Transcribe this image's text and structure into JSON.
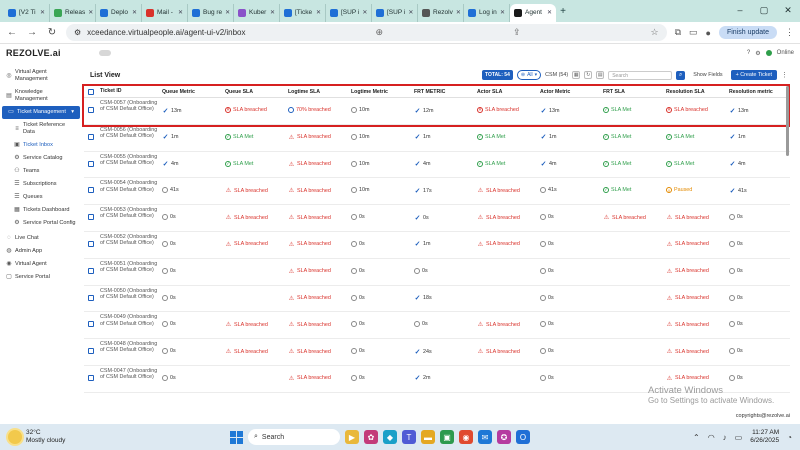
{
  "browser": {
    "tabs": [
      {
        "label": "[V2 Ti",
        "color": "#1f6fd6"
      },
      {
        "label": "Releas",
        "color": "#3aa655"
      },
      {
        "label": "Deplo",
        "color": "#1f6fd6"
      },
      {
        "label": "Mail -",
        "color": "#d9322b"
      },
      {
        "label": "Bug re",
        "color": "#1f6fd6"
      },
      {
        "label": "Kuber",
        "color": "#8a52c9"
      },
      {
        "label": "[Ticke",
        "color": "#1f6fd6"
      },
      {
        "label": "[SUP i",
        "color": "#1f6fd6"
      },
      {
        "label": "[SUP i",
        "color": "#1f6fd6"
      },
      {
        "label": "Rezolv",
        "color": "#555555"
      },
      {
        "label": "Log in",
        "color": "#1f6fd6"
      },
      {
        "label": "Agent",
        "color": "#1a1a1a",
        "active": true
      }
    ],
    "url": "xceedance.virtualpeople.ai/agent-ui-v2/inbox",
    "finish_update": "Finish update"
  },
  "app": {
    "logo": "REZOLVE.ai",
    "user_status": "Online"
  },
  "sidebar": {
    "items": [
      {
        "label": "Virtual Agent Management",
        "icon": "bot-icon"
      },
      {
        "label": "Knowledge Management",
        "icon": "book-icon"
      },
      {
        "label": "Ticket Management",
        "icon": "ticket-icon",
        "active": true
      },
      {
        "label": "Ticket Reference Data",
        "icon": "list-icon",
        "sub": true
      },
      {
        "label": "Ticket Inbox",
        "icon": "inbox-icon",
        "sub": true,
        "current": true
      },
      {
        "label": "Service Catalog",
        "icon": "catalog-icon",
        "sub": true
      },
      {
        "label": "Teams",
        "icon": "team-icon",
        "sub": true
      },
      {
        "label": "Subscriptions",
        "icon": "subscription-icon",
        "sub": true
      },
      {
        "label": "Queues",
        "icon": "queue-icon",
        "sub": true
      },
      {
        "label": "Tickets Dashboard",
        "icon": "dashboard-icon",
        "sub": true
      },
      {
        "label": "Service Portal Config",
        "icon": "config-icon",
        "sub": true
      },
      {
        "label": "Live Chat",
        "icon": "chat-icon"
      },
      {
        "label": "Admin App",
        "icon": "admin-icon"
      },
      {
        "label": "Virtual Agent",
        "icon": "agent-icon"
      },
      {
        "label": "Service Portal",
        "icon": "portal-icon"
      }
    ]
  },
  "list": {
    "title": "List View",
    "total": "TOTAL: 54",
    "filter_label": "All",
    "csm_select": "CSM (54)",
    "search_placeholder": "Search",
    "show_fields": "Show Fields",
    "create_ticket": "+ Create Ticket",
    "columns": [
      "Ticket ID",
      "Queue Metric",
      "Queue SLA",
      "Logtime SLA",
      "Logtime Metric",
      "FRT METRIC",
      "Actor SLA",
      "Actor Metric",
      "FRT SLA",
      "Resolution SLA",
      "Resolution metric"
    ],
    "rows": [
      {
        "id": "CSM-0057 (Onboarding of CSM Default Office)",
        "cells": [
          [
            "check",
            "13m"
          ],
          [
            "breach",
            "SLA breached"
          ],
          [
            "clock-blue",
            "70% breached"
          ],
          [
            "clock",
            "10m"
          ],
          [
            "check",
            "12m"
          ],
          [
            "breach",
            "SLA breached"
          ],
          [
            "check",
            "13m"
          ],
          [
            "met",
            "SLA Met"
          ],
          [
            "breach",
            "SLA breached"
          ],
          [
            "check",
            "13m"
          ]
        ]
      },
      {
        "id": "CSM-0056 (Onboarding of CSM Default Office)",
        "cells": [
          [
            "check",
            "1m"
          ],
          [
            "met",
            "SLA Met"
          ],
          [
            "fire",
            "SLA breached"
          ],
          [
            "clock",
            "10m"
          ],
          [
            "check",
            "1m"
          ],
          [
            "met",
            "SLA Met"
          ],
          [
            "check",
            "1m"
          ],
          [
            "met",
            "SLA Met"
          ],
          [
            "met",
            "SLA Met"
          ],
          [
            "check",
            "1m"
          ]
        ]
      },
      {
        "id": "CSM-0055 (Onboarding of CSM Default Office)",
        "cells": [
          [
            "check",
            "4m"
          ],
          [
            "met",
            "SLA Met"
          ],
          [
            "fire",
            "SLA breached"
          ],
          [
            "clock",
            "10m"
          ],
          [
            "check",
            "4m"
          ],
          [
            "met",
            "SLA Met"
          ],
          [
            "check",
            "4m"
          ],
          [
            "met",
            "SLA Met"
          ],
          [
            "met",
            "SLA Met"
          ],
          [
            "check",
            "4m"
          ]
        ]
      },
      {
        "id": "CSM-0054 (Onboarding of CSM Default Office)",
        "cells": [
          [
            "clock",
            "41s"
          ],
          [
            "fire",
            "SLA breached"
          ],
          [
            "fire",
            "SLA breached"
          ],
          [
            "clock",
            "10m"
          ],
          [
            "check",
            "17s"
          ],
          [
            "fire",
            "SLA breached"
          ],
          [
            "clock",
            "41s"
          ],
          [
            "met",
            "SLA Met"
          ],
          [
            "paused",
            "Paused"
          ],
          [
            "check",
            "41s"
          ]
        ]
      },
      {
        "id": "CSM-0053 (Onboarding of CSM Default Office)",
        "cells": [
          [
            "clock",
            "0s"
          ],
          [
            "fire",
            "SLA breached"
          ],
          [
            "fire",
            "SLA breached"
          ],
          [
            "clock",
            "0s"
          ],
          [
            "check",
            "0s"
          ],
          [
            "fire",
            "SLA breached"
          ],
          [
            "clock",
            "0s"
          ],
          [
            "fire",
            "SLA breached"
          ],
          [
            "fire",
            "SLA breached"
          ],
          [
            "clock",
            "0s"
          ]
        ]
      },
      {
        "id": "CSM-0052 (Onboarding of CSM Default Office)",
        "cells": [
          [
            "clock",
            "0s"
          ],
          [
            "fire",
            "SLA breached"
          ],
          [
            "fire",
            "SLA breached"
          ],
          [
            "clock",
            "0s"
          ],
          [
            "check",
            "1m"
          ],
          [
            "fire",
            "SLA breached"
          ],
          [
            "clock",
            "0s"
          ],
          [
            "",
            ""
          ],
          [
            "fire",
            "SLA breached"
          ],
          [
            "clock",
            "0s"
          ]
        ]
      },
      {
        "id": "CSM-0051 (Onboarding of CSM Default Office)",
        "cells": [
          [
            "clock",
            "0s"
          ],
          [
            "",
            ""
          ],
          [
            "fire",
            "SLA breached"
          ],
          [
            "clock",
            "0s"
          ],
          [
            "clock",
            "0s"
          ],
          [
            "",
            ""
          ],
          [
            "clock",
            "0s"
          ],
          [
            "",
            ""
          ],
          [
            "fire",
            "SLA breached"
          ],
          [
            "clock",
            "0s"
          ]
        ]
      },
      {
        "id": "CSM-0050 (Onboarding of CSM Default Office)",
        "cells": [
          [
            "clock",
            "0s"
          ],
          [
            "",
            ""
          ],
          [
            "fire",
            "SLA breached"
          ],
          [
            "clock",
            "0s"
          ],
          [
            "check",
            "18s"
          ],
          [
            "",
            ""
          ],
          [
            "clock",
            "0s"
          ],
          [
            "",
            ""
          ],
          [
            "fire",
            "SLA breached"
          ],
          [
            "clock",
            "0s"
          ]
        ]
      },
      {
        "id": "CSM-0049 (Onboarding of CSM Default Office)",
        "cells": [
          [
            "clock",
            "0s"
          ],
          [
            "fire",
            "SLA breached"
          ],
          [
            "fire",
            "SLA breached"
          ],
          [
            "clock",
            "0s"
          ],
          [
            "clock",
            "0s"
          ],
          [
            "fire",
            "SLA breached"
          ],
          [
            "clock",
            "0s"
          ],
          [
            "",
            ""
          ],
          [
            "fire",
            "SLA breached"
          ],
          [
            "clock",
            "0s"
          ]
        ]
      },
      {
        "id": "CSM-0048 (Onboarding of CSM Default Office)",
        "cells": [
          [
            "clock",
            "0s"
          ],
          [
            "fire",
            "SLA breached"
          ],
          [
            "fire",
            "SLA breached"
          ],
          [
            "clock",
            "0s"
          ],
          [
            "check",
            "24s"
          ],
          [
            "fire",
            "SLA breached"
          ],
          [
            "clock",
            "0s"
          ],
          [
            "",
            ""
          ],
          [
            "fire",
            "SLA breached"
          ],
          [
            "clock",
            "0s"
          ]
        ]
      },
      {
        "id": "CSM-0047 (Onboarding of CSM Default Office)",
        "cells": [
          [
            "clock",
            "0s"
          ],
          [
            "",
            ""
          ],
          [
            "fire",
            "SLA breached"
          ],
          [
            "clock",
            "0s"
          ],
          [
            "check",
            "2m"
          ],
          [
            "",
            ""
          ],
          [
            "clock",
            "0s"
          ],
          [
            "",
            ""
          ],
          [
            "fire",
            "SLA breached"
          ],
          [
            "clock",
            "0s"
          ]
        ]
      }
    ]
  },
  "watermark": {
    "line1": "Activate Windows",
    "line2": "Go to Settings to activate Windows."
  },
  "copyright": "copyrights@rezolve.ai",
  "taskbar": {
    "temp": "32°C",
    "weather": "Mostly cloudy",
    "search": "Search",
    "time": "11:27 AM",
    "date": "6/26/2025"
  }
}
